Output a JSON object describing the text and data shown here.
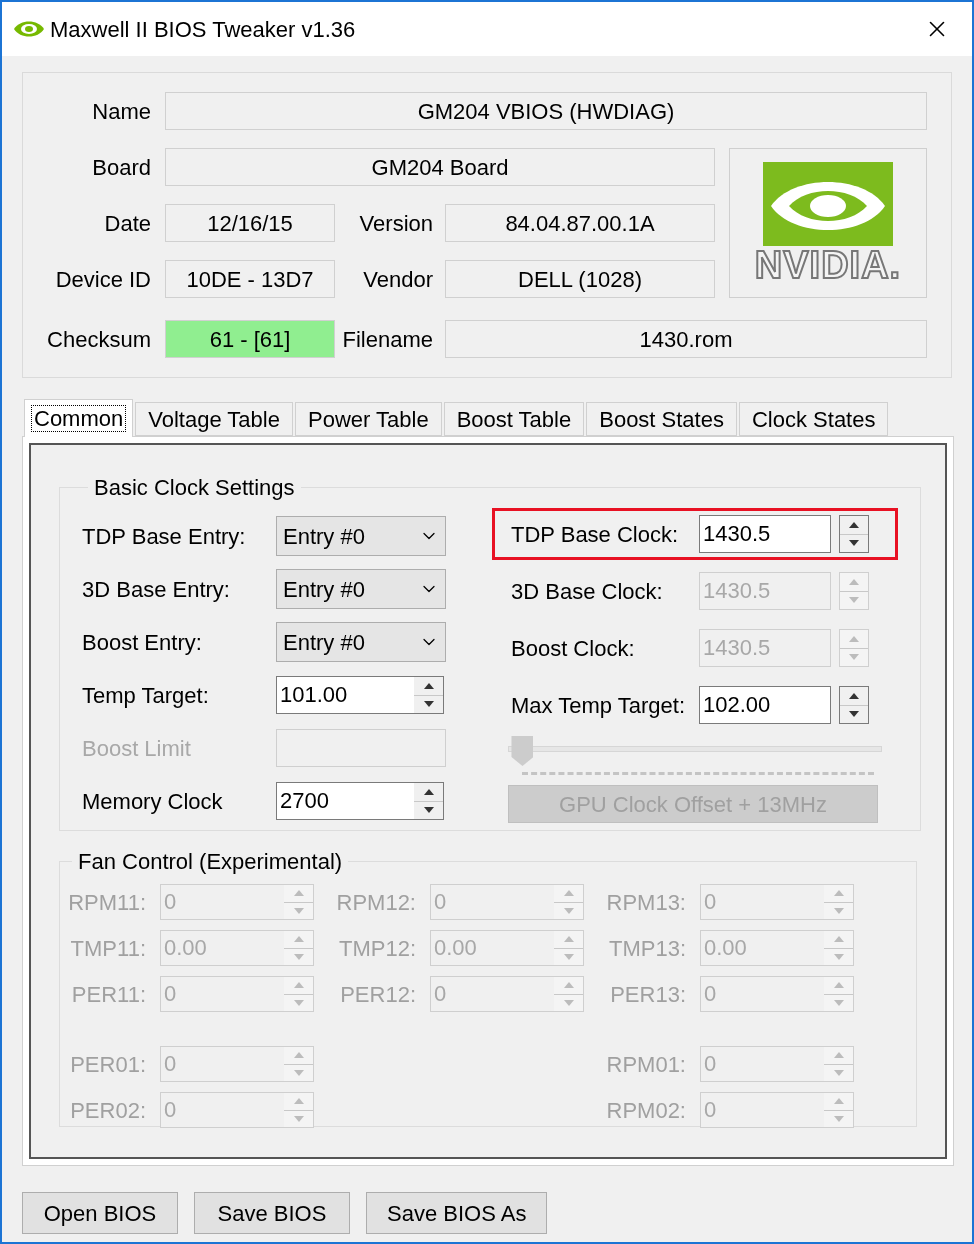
{
  "window": {
    "title": "Maxwell II BIOS Tweaker v1.36"
  },
  "header": {
    "name": {
      "label": "Name",
      "value": "GM204 VBIOS (HWDIAG)"
    },
    "board": {
      "label": "Board",
      "value": "GM204 Board"
    },
    "date": {
      "label": "Date",
      "value": "12/16/15"
    },
    "version": {
      "label": "Version",
      "value": "84.04.87.00.1A"
    },
    "device_id": {
      "label": "Device ID",
      "value": "10DE - 13D7"
    },
    "vendor": {
      "label": "Vendor",
      "value": "DELL (1028)"
    },
    "checksum": {
      "label": "Checksum",
      "value": "61 - [61]",
      "valid": true
    },
    "filename": {
      "label": "Filename",
      "value": "1430.rom"
    },
    "logo": {
      "text": "NVIDIA."
    }
  },
  "tabs": [
    {
      "label": "Common",
      "selected": true
    },
    {
      "label": "Voltage Table",
      "selected": false
    },
    {
      "label": "Power Table",
      "selected": false
    },
    {
      "label": "Boost Table",
      "selected": false
    },
    {
      "label": "Boost States",
      "selected": false
    },
    {
      "label": "Clock States",
      "selected": false
    }
  ],
  "basic_clock": {
    "title": "Basic Clock Settings",
    "left": [
      {
        "kind": "dropdown",
        "label": "TDP Base Entry:",
        "value": "Entry #0",
        "disabled": false
      },
      {
        "kind": "dropdown",
        "label": "3D Base Entry:",
        "value": "Entry #0",
        "disabled": false
      },
      {
        "kind": "dropdown",
        "label": "Boost Entry:",
        "value": "Entry #0",
        "disabled": false
      },
      {
        "kind": "spin",
        "label": "Temp Target:",
        "value": "101.00",
        "disabled": false
      },
      {
        "kind": "text",
        "label": "Boost Limit",
        "disabled": true
      },
      {
        "kind": "spin",
        "label": "Memory Clock",
        "value": "2700",
        "disabled": false
      }
    ],
    "right": [
      {
        "label": "TDP Base Clock:",
        "value": "1430.5",
        "disabled": false,
        "highlighted": true
      },
      {
        "label": "3D Base Clock:",
        "value": "1430.5",
        "disabled": true,
        "highlighted": false
      },
      {
        "label": "Boost Clock:",
        "value": "1430.5",
        "disabled": true,
        "highlighted": false
      },
      {
        "label": "Max Temp Target:",
        "value": "102.00",
        "disabled": false,
        "highlighted": false
      }
    ],
    "slider": {
      "level": 0.02,
      "disabled": true
    },
    "offset_button": {
      "label": "GPU Clock Offset + 13MHz",
      "disabled": true
    }
  },
  "fan_control": {
    "title": "Fan Control (Experimental)",
    "disabled": true,
    "sections": [
      {
        "rows": [
          {
            "left": {
              "label": "RPM11:",
              "value": "0"
            },
            "middle": {
              "label": "RPM12:",
              "value": "0"
            },
            "right": {
              "label": "RPM13:",
              "value": "0"
            }
          },
          {
            "left": {
              "label": "TMP11:",
              "value": "0.00"
            },
            "middle": {
              "label": "TMP12:",
              "value": "0.00"
            },
            "right": {
              "label": "TMP13:",
              "value": "0.00"
            }
          },
          {
            "left": {
              "label": "PER11:",
              "value": "0"
            },
            "middle": {
              "label": "PER12:",
              "value": "0"
            },
            "right": {
              "label": "PER13:",
              "value": "0"
            }
          }
        ]
      },
      {
        "rows": [
          {
            "left": {
              "label": "PER01:",
              "value": "0"
            },
            "right": {
              "label": "RPM01:",
              "value": "0"
            }
          },
          {
            "left": {
              "label": "PER02:",
              "value": "0"
            },
            "right": {
              "label": "RPM02:",
              "value": "0"
            }
          }
        ]
      }
    ]
  },
  "buttons": [
    {
      "label": "Open BIOS"
    },
    {
      "label": "Save BIOS"
    },
    {
      "label": "Save BIOS As"
    }
  ]
}
